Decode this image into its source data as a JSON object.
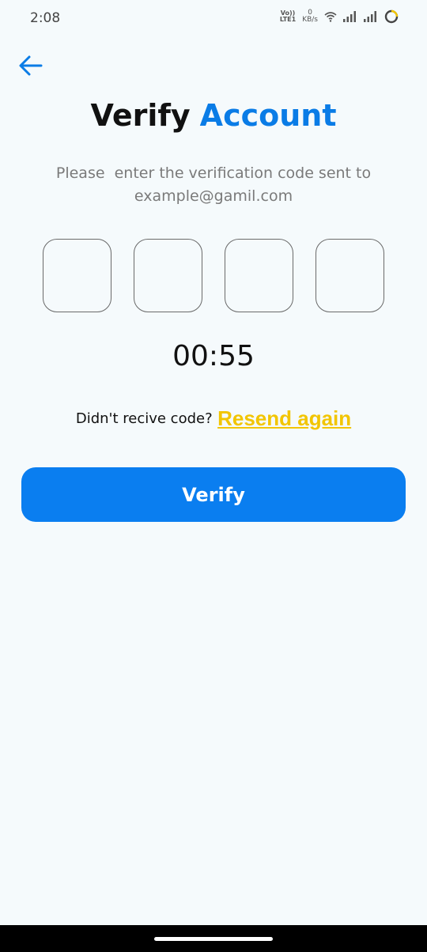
{
  "status_bar": {
    "time": "2:08",
    "volte_top": "Vo))",
    "volte_bottom": "LTE1",
    "net_speed_value": "0",
    "net_speed_unit": "KB/s"
  },
  "header": {
    "title_part1": "Verify",
    "title_part2": "Account"
  },
  "subtitle": {
    "line1": "Please  enter the verification code sent to",
    "line2": "example@gamil.com"
  },
  "otp": {
    "digits": [
      "",
      "",
      "",
      ""
    ]
  },
  "timer": "00:55",
  "resend": {
    "prompt": "Didn't recive code?",
    "link": "Resend again"
  },
  "verify_button": {
    "label": "Verify"
  },
  "colors": {
    "accent": "#0a7ef0",
    "title_accent": "#0a7ce6",
    "link": "#f2c500",
    "background": "#f5fafc"
  },
  "icons": {
    "back": "arrow-left-icon",
    "wifi": "wifi-icon",
    "signal": "signal-icon",
    "battery": "battery-ring-icon"
  }
}
